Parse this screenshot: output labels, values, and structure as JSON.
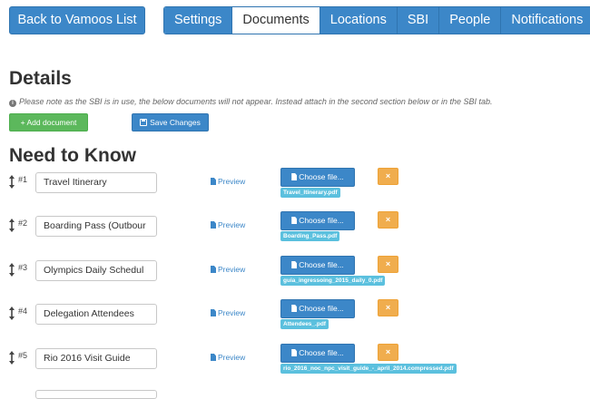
{
  "nav": {
    "back_label": "Back to Vamoos List",
    "tabs": [
      {
        "label": "Settings",
        "active": false
      },
      {
        "label": "Documents",
        "active": true
      },
      {
        "label": "Locations",
        "active": false
      },
      {
        "label": "SBI",
        "active": false
      },
      {
        "label": "People",
        "active": false
      },
      {
        "label": "Notifications",
        "active": false
      }
    ]
  },
  "details": {
    "title": "Details",
    "note": "Please note as the SBI is in use, the below documents will not appear. Instead attach in the second section below or in the SBI tab.",
    "add_label": "+ Add document",
    "save_label": "Save Changes"
  },
  "ntk": {
    "title": "Need to Know",
    "preview_label": "Preview",
    "choose_label": "Choose file...",
    "delete_label": "×",
    "rows": [
      {
        "num": "#1",
        "name": "Travel Itinerary",
        "file": "Travel_Itinerary.pdf"
      },
      {
        "num": "#2",
        "name": "Boarding Pass (Outbour",
        "file": "Boarding_Pass.pdf"
      },
      {
        "num": "#3",
        "name": "Olympics Daily Schedul",
        "file": "guia_ingressoing_2015_daily_0.pdf"
      },
      {
        "num": "#4",
        "name": "Delegation Attendees",
        "file": "Attendees_.pdf"
      },
      {
        "num": "#5",
        "name": "Rio 2016 Visit Guide",
        "file": "rio_2016_noc_npc_visit_guide_-_april_2014.compressed.pdf"
      }
    ]
  },
  "colors": {
    "primary": "#3c87c8",
    "success": "#5cb85c",
    "warning": "#f0ad4e",
    "info": "#5bc0de"
  }
}
